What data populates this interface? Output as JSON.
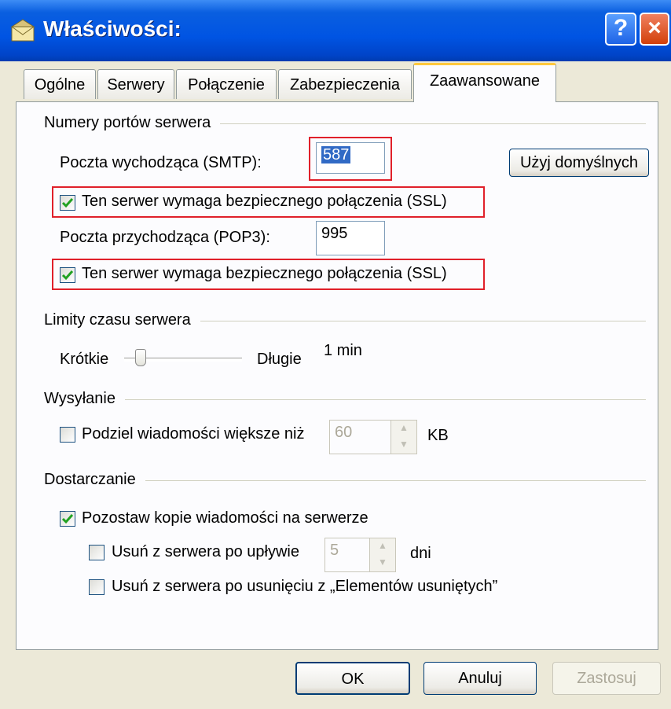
{
  "window": {
    "title": "Właściwości:",
    "help_glyph": "?",
    "close_glyph": "×"
  },
  "tabs": [
    "Ogólne",
    "Serwery",
    "Połączenie",
    "Zabezpieczenia",
    "Zaawansowane"
  ],
  "ports": {
    "group_label": "Numery portów serwera",
    "smtp_label": "Poczta wychodząca (SMTP):",
    "smtp_value": "587",
    "use_defaults_label": "Użyj domyślnych",
    "ssl_smtp_label": "Ten serwer wymaga bezpiecznego połączenia (SSL)",
    "ssl_smtp_checked": true,
    "pop3_label": "Poczta przychodząca (POP3):",
    "pop3_value": "995",
    "ssl_pop3_label": "Ten serwer wymaga bezpiecznego połączenia (SSL)",
    "ssl_pop3_checked": true
  },
  "timeouts": {
    "group_label": "Limity czasu serwera",
    "short_label": "Krótkie",
    "long_label": "Długie",
    "value_text": "1 min"
  },
  "sending": {
    "group_label": "Wysyłanie",
    "split_label": "Podziel wiadomości większe niż",
    "split_checked": false,
    "split_value": "60",
    "unit": "KB"
  },
  "delivery": {
    "group_label": "Dostarczanie",
    "keep_label": "Pozostaw kopie wiadomości na serwerze",
    "keep_checked": true,
    "remove_after_label": "Usuń z serwera po upływie",
    "remove_after_checked": false,
    "remove_after_value": "5",
    "days_unit": "dni",
    "remove_deleted_label": "Usuń z serwera po usunięciu z „Elementów usuniętych”",
    "remove_deleted_checked": false
  },
  "buttons": {
    "ok": "OK",
    "cancel": "Anuluj",
    "apply": "Zastosuj"
  },
  "colors": {
    "title_blue": "#0054e3",
    "highlight_red": "#e0202a",
    "check_green": "#21a121",
    "active_tab_accent": "#ffc83c"
  }
}
